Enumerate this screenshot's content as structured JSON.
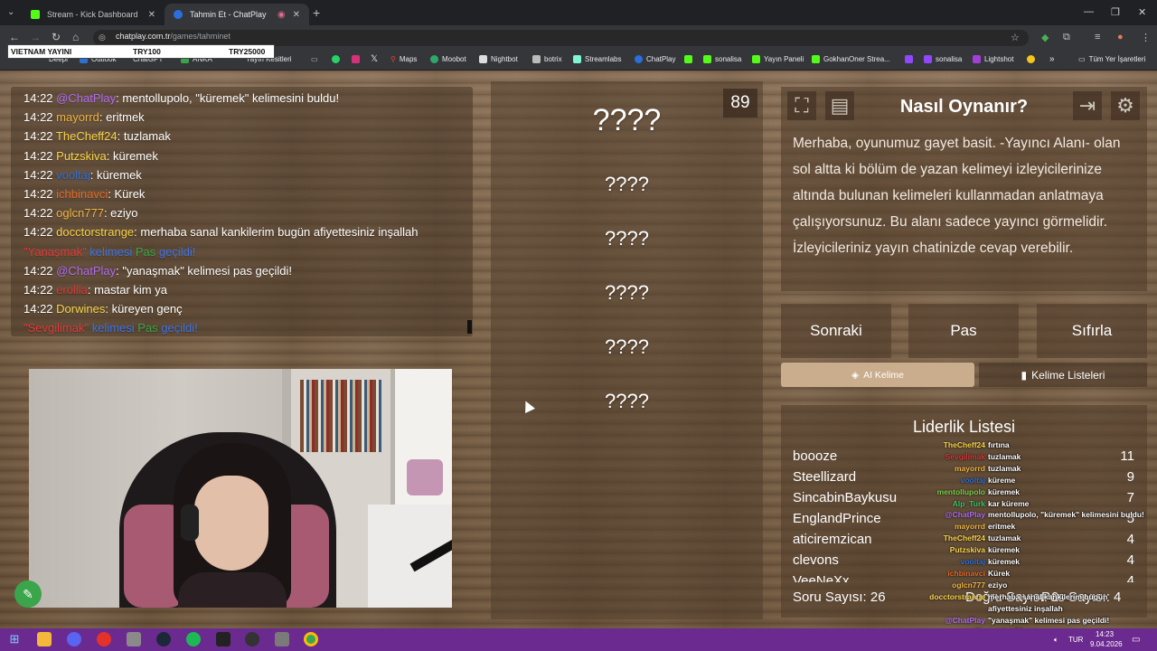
{
  "browser": {
    "tabs": [
      {
        "label": "Stream - Kick Dashboard",
        "active": false
      },
      {
        "label": "Tahmin Et - ChatPlay",
        "active": true
      }
    ],
    "url_host": "chatplay.com.tr",
    "url_path": "/games/tahminet",
    "bookmarks": [
      "Deepl",
      "Outlook",
      "ChatGPT",
      "ANKA",
      "Yayın Kesitleri",
      "Maps",
      "Moobot",
      "Nightbot",
      "botrix",
      "Streamlabs",
      "ChatPlay",
      "sonalisa",
      "Yayın Paneli",
      "GokhanOner Strea...",
      "sonalisa",
      "Lightshot",
      "Tüm Yer İşaretleri"
    ],
    "overlay": {
      "left": "VIETNAM YAYINI",
      "mid": "TRY100",
      "right": "TRY25000"
    }
  },
  "chat": {
    "lines": [
      {
        "time": "14:22",
        "user": "@ChatPlay",
        "user_color": "#b06cf0",
        "msg": ": mentollupolo, \"küremek\" kelimesini buldu!"
      },
      {
        "time": "14:22",
        "user": "mayorrd",
        "user_color": "#f0b542",
        "msg": ": eritmek"
      },
      {
        "time": "14:22",
        "user": "TheCheff24",
        "user_color": "#f7d34a",
        "msg": ": tuzlamak"
      },
      {
        "time": "14:22",
        "user": "Putzskiva",
        "user_color": "#f7d34a",
        "msg": ": küremek"
      },
      {
        "time": "14:22",
        "user": "vooltaj",
        "user_color": "#2f6fd6",
        "msg": ": küremek"
      },
      {
        "time": "14:22",
        "user": "ichbinavci",
        "user_color": "#e06a2a",
        "msg": ": Kürek"
      },
      {
        "time": "14:22",
        "user": "oglcn777",
        "user_color": "#f0b542",
        "msg": ": eziyo"
      },
      {
        "time": "14:22",
        "user": "docctorstrange",
        "user_color": "#f7d34a",
        "msg": ": merhaba sanal kankilerim bugün afiyettesiniz inşallah"
      },
      {
        "time": "",
        "user": "",
        "user_color": "",
        "msg": "",
        "special": "pass1"
      },
      {
        "time": "14:22",
        "user": "@ChatPlay",
        "user_color": "#b06cf0",
        "msg": ": \"yanaşmak\" kelimesi pas geçildi!"
      },
      {
        "time": "14:22",
        "user": "erollla",
        "user_color": "#d43a3a",
        "msg": ": mastar kim ya"
      },
      {
        "time": "14:22",
        "user": "Dorwines",
        "user_color": "#f7d34a",
        "msg": ": küreyen genç"
      },
      {
        "time": "",
        "user": "",
        "user_color": "",
        "msg": "",
        "special": "pass2"
      }
    ],
    "pass1": {
      "word": "\"Yanaşmak\"",
      "w1": "kelimesi",
      "w2": "Pas",
      "w3": "geçildi!"
    },
    "pass2": {
      "word": "\"Sevgilimak\"",
      "w1": "kelimesi",
      "w2": "Pas",
      "w3": "geçildi!"
    }
  },
  "game": {
    "counter": "89",
    "main_word": "????",
    "words": [
      "????",
      "????",
      "????",
      "????",
      "????"
    ]
  },
  "howto": {
    "title": "Nasıl Oynanır?",
    "text": "Merhaba, oyunumuz gayet basit. -Yayıncı Alanı- olan sol altta ki bölüm de yazan kelimeyi izleyicilerinize altında bulunan kelimeleri kullanmadan anlatmaya çalışıyorsunuz. Bu alanı sadece yayıncı görmelidir. İzleyicileriniz yayın chatinizde cevap verebilir."
  },
  "actions": {
    "next": "Sonraki",
    "pass": "Pas",
    "reset": "Sıfırla"
  },
  "tabs": {
    "ai": "AI Kelime",
    "lists": "Kelime Listeleri"
  },
  "leaderboard": {
    "title": "Liderlik Listesi",
    "rows": [
      {
        "name": "boooze",
        "score": "11"
      },
      {
        "name": "Steellizard",
        "score": "9"
      },
      {
        "name": "SincabinBaykusu",
        "score": "7"
      },
      {
        "name": "EnglandPrince",
        "score": "5"
      },
      {
        "name": "aticiremzican",
        "score": "4"
      },
      {
        "name": "clevons",
        "score": "4"
      },
      {
        "name": "VeeNeXx",
        "score": "4"
      }
    ],
    "question_count": "Soru Sayısı: 26",
    "correct_count": "Doğru Sayısı: 0",
    "pass_count": "Pas Sayısı: 4"
  },
  "overlay_chat": [
    {
      "user": "TheCheff24",
      "color": "#f7d34a",
      "msg": "fırtına"
    },
    {
      "user": "Sevgilimak",
      "color": "#d43a3a",
      "msg": "tuzlamak"
    },
    {
      "user": "mayorrd",
      "color": "#f0b542",
      "msg": "tuzlamak"
    },
    {
      "user": "vooltaj",
      "color": "#2f6fd6",
      "msg": "küreme"
    },
    {
      "user": "mentollupolo",
      "color": "#7ad04a",
      "msg": "küremek"
    },
    {
      "user": "Alp_Turk",
      "color": "#3ac46a",
      "msg": "kar küreme"
    },
    {
      "user": "@ChatPlay",
      "color": "#b06cf0",
      "msg": "mentollupolo, \"küremek\" kelimesini buldu!"
    },
    {
      "user": "mayorrd",
      "color": "#f0b542",
      "msg": "eritmek"
    },
    {
      "user": "TheCheff24",
      "color": "#f7d34a",
      "msg": "tuzlamak"
    },
    {
      "user": "Putzskiva",
      "color": "#f7d34a",
      "msg": "küremek"
    },
    {
      "user": "vooltaj",
      "color": "#2f6fd6",
      "msg": "küremek"
    },
    {
      "user": "ichbinavci",
      "color": "#e06a2a",
      "msg": "Kürek"
    },
    {
      "user": "oglcn777",
      "color": "#f0b542",
      "msg": "eziyo"
    },
    {
      "user": "docctorstrange",
      "color": "#f7d34a",
      "msg": "merhaba sanal kankilerim bugün"
    },
    {
      "user": "",
      "color": "#fff",
      "msg": "afiyettesiniz inşallah"
    },
    {
      "user": "@ChatPlay",
      "color": "#b06cf0",
      "msg": "\"yanaşmak\" kelimesi pas geçildi!"
    },
    {
      "user": "erollla",
      "color": "#d43a3a",
      "msg": "mastar kim ya"
    },
    {
      "user": "Dorwines",
      "color": "#f7d34a",
      "msg": "küreyen genç"
    }
  ],
  "taskbar": {
    "lang": "TUR",
    "time": "14:23",
    "date": "9.04.2026"
  }
}
